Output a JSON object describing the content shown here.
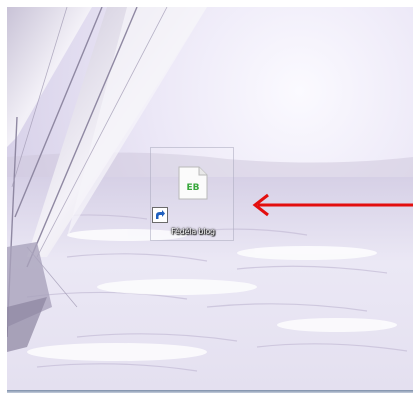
{
  "desktop": {
    "icon": {
      "label": "Fédéla blog",
      "badge": "EB",
      "icon_name": "document-file-icon",
      "has_shortcut_arrow": true
    },
    "annotation": {
      "icon_name": "red-arrow-left-icon",
      "color": "#e30e0e"
    },
    "wallpaper_colors": {
      "sky": "#ece8f7",
      "sea": "#e6e2f2",
      "sail": "#f2f0f6"
    }
  }
}
